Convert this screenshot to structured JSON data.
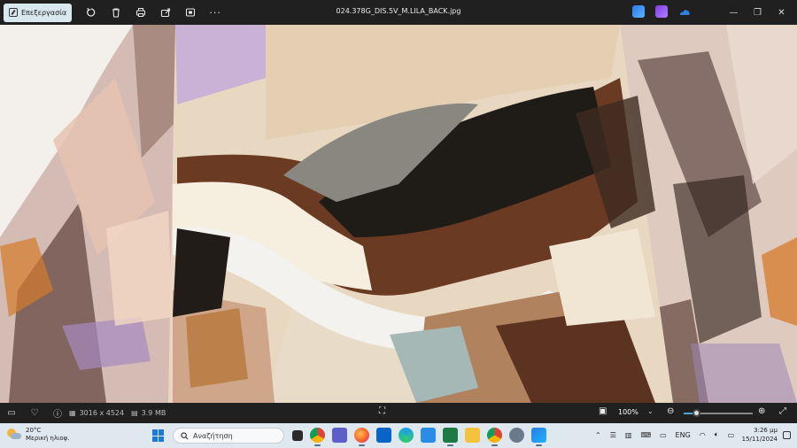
{
  "toolbar": {
    "edit_label": "Επεξεργασία",
    "icons": [
      "rotate-icon",
      "delete-icon",
      "print-icon",
      "share-icon",
      "slideshow-icon",
      "more-icon"
    ],
    "more_label": "···"
  },
  "window": {
    "title": "024.378G_DIS.5V_M.LILA_BACK.jpg",
    "minimize": "—",
    "restore": "❐",
    "close": "✕"
  },
  "statusbar": {
    "dimensions": "3016 x 4524",
    "filesize": "3.9 MB",
    "zoom": "100%",
    "zoom_level": 0.18
  },
  "taskbar": {
    "temperature": "20°C",
    "weather": "Μερική ηλιοφ.",
    "search_placeholder": "Αναζήτηση",
    "language": "ENG",
    "time": "3:26 μμ",
    "date": "15/11/2024"
  },
  "colors": {
    "accent": "#4ca3dd",
    "toolbar_bg": "#202020",
    "taskbar_bg": "#dfe7ef"
  }
}
